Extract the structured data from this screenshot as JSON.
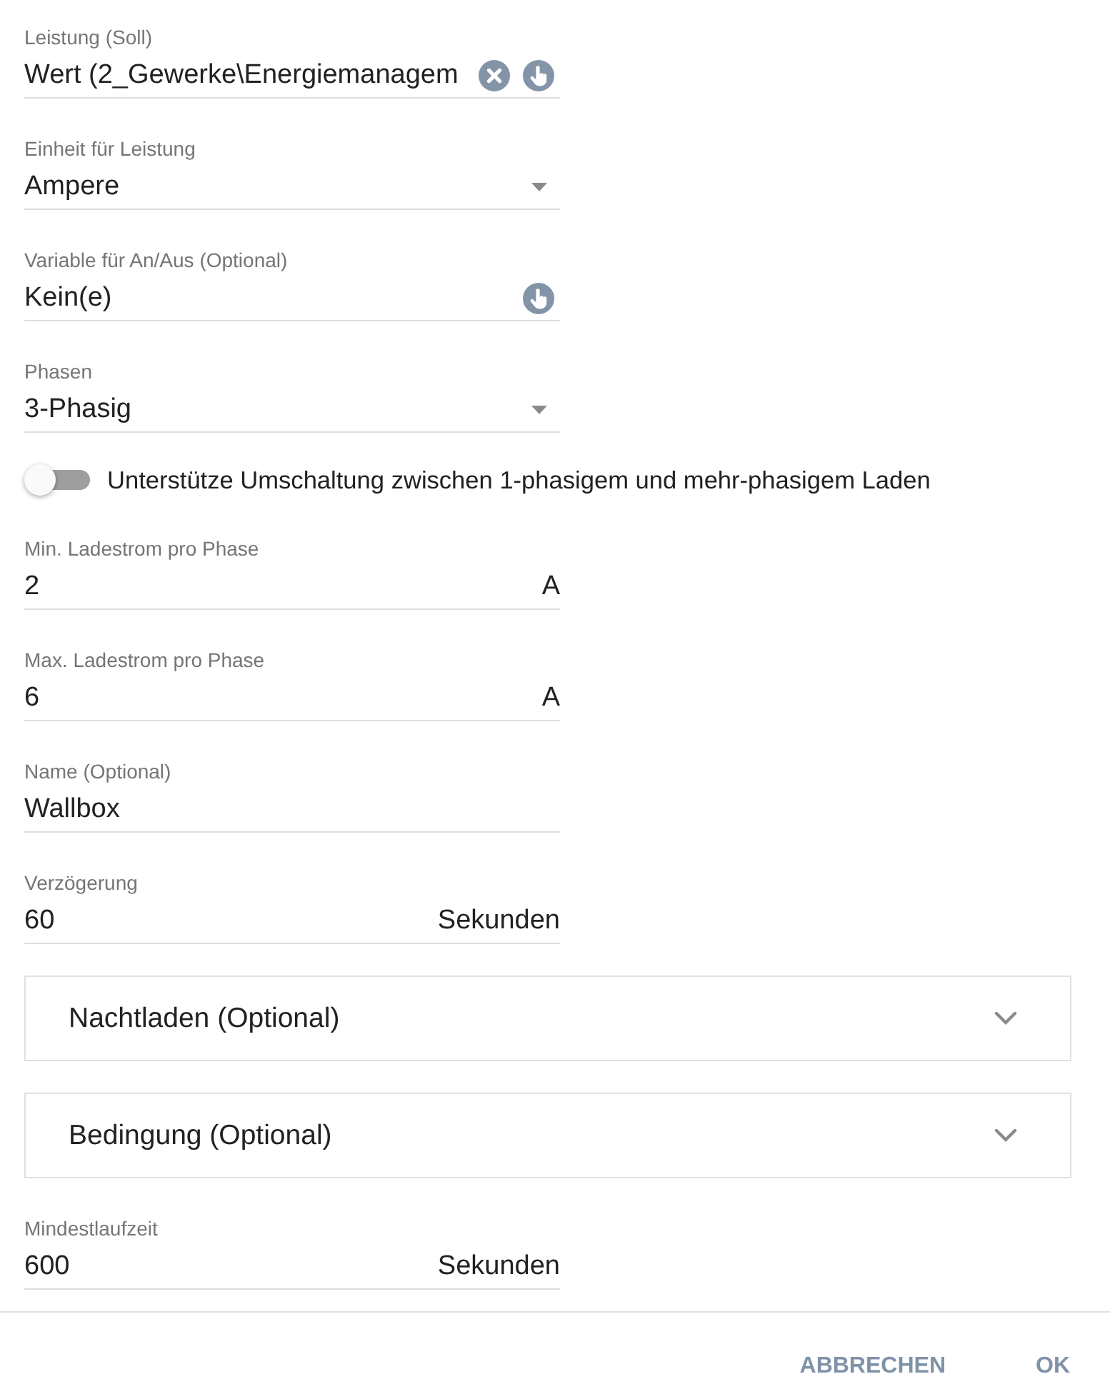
{
  "fields": [
    {
      "kind": "variable",
      "label": "Leistung (Soll)",
      "value": "Wert (2_Gewerke\\Energiemanagem",
      "clearable": true
    },
    {
      "kind": "dropdown",
      "label": "Einheit für Leistung",
      "value": "Ampere"
    },
    {
      "kind": "variable",
      "label": "Variable für An/Aus (Optional)",
      "value": "Kein(e)",
      "clearable": false
    },
    {
      "kind": "dropdown",
      "label": "Phasen",
      "value": "3-Phasig"
    },
    {
      "kind": "toggle",
      "label": "Unterstütze Umschaltung zwischen 1-phasigem und mehr-phasigem Laden",
      "on": false
    },
    {
      "kind": "number",
      "label": "Min. Ladestrom pro Phase",
      "value": "2",
      "unit": "A"
    },
    {
      "kind": "number",
      "label": "Max. Ladestrom pro Phase",
      "value": "6",
      "unit": "A"
    },
    {
      "kind": "text",
      "label": "Name (Optional)",
      "value": "Wallbox"
    },
    {
      "kind": "number",
      "label": "Verzögerung",
      "value": "60",
      "unit": "Sekunden"
    },
    {
      "kind": "panel",
      "title": "Nachtladen (Optional)",
      "expanded": false
    },
    {
      "kind": "panel",
      "title": "Bedingung (Optional)",
      "expanded": false
    },
    {
      "kind": "number",
      "label": "Mindestlaufzeit",
      "value": "600",
      "unit": "Sekunden"
    }
  ],
  "buttons": [
    "ABBRECHEN",
    "OK"
  ]
}
